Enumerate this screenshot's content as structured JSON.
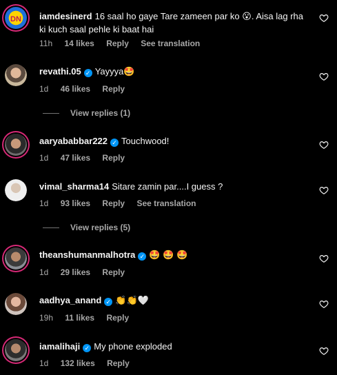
{
  "comments": [
    {
      "username": "iamdesinerd",
      "text": "16 saal ho gaye Tare zameen par ko 😮. Aisa lag rha ki kuch saal pehle ki baat hai",
      "time": "11h",
      "likes": "14 likes",
      "reply": "Reply",
      "translate": "See translation"
    },
    {
      "username": "revathi.05",
      "text": "Yayyya🤩",
      "time": "1d",
      "likes": "46 likes",
      "reply": "Reply",
      "view_replies": "View replies (1)"
    },
    {
      "username": "aaryababbar222",
      "text": "Touchwood!",
      "time": "1d",
      "likes": "47 likes",
      "reply": "Reply"
    },
    {
      "username": "vimal_sharma14",
      "text": "Sitare zamin par....I guess ?",
      "time": "1d",
      "likes": "93 likes",
      "reply": "Reply",
      "translate": "See translation",
      "view_replies": "View replies (5)"
    },
    {
      "username": "theanshumanmalhotra",
      "text": "🤩 🤩 🤩",
      "time": "1d",
      "likes": "29 likes",
      "reply": "Reply"
    },
    {
      "username": "aadhya_anand",
      "text": "👏👏🤍",
      "time": "19h",
      "likes": "11 likes",
      "reply": "Reply"
    },
    {
      "username": "iamalihaji",
      "text": "My phone exploded",
      "time": "1d",
      "likes": "132 likes",
      "reply": "Reply"
    }
  ],
  "icons": {
    "like": "heart-outline-icon",
    "verified": "verified-badge-icon"
  },
  "colors": {
    "background": "#000000",
    "secondary_text": "#a8a8a8",
    "verified_blue": "#0095f6",
    "story_ring": "#d62976"
  }
}
